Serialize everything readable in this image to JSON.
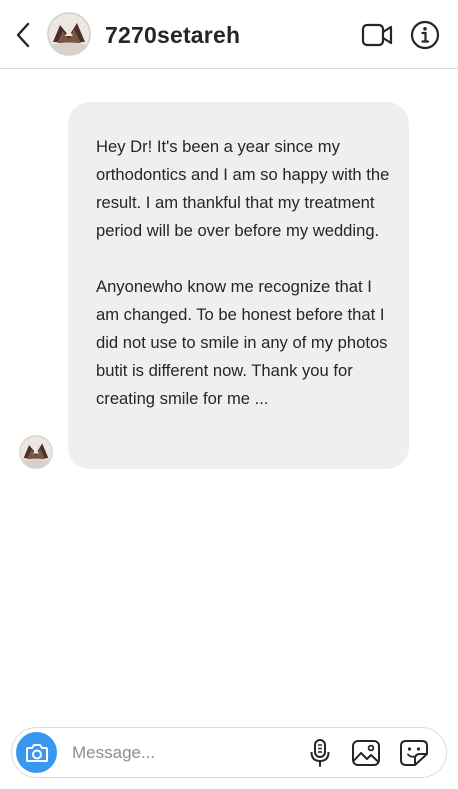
{
  "header": {
    "username": "7270setareh",
    "icons": {
      "back": "chevron-left-icon",
      "video": "video-camera-icon",
      "info": "info-icon"
    }
  },
  "thread": {
    "messages": [
      {
        "paragraphs": [
          "Hey Dr! It's been a year since my orthodontics and I am so happy with the result. I am thankful that my treatment period will be over before my wedding.",
          "Anyonewho know me recognize that I am changed. To be honest before that I did not use to smile in any of my photos butit is different now. Thank you for creating smile for me ..."
        ]
      }
    ]
  },
  "composer": {
    "placeholder": "Message...",
    "value": "",
    "icons": {
      "camera": "camera-icon",
      "mic": "microphone-icon",
      "gallery": "image-gallery-icon",
      "sticker": "sticker-icon"
    }
  },
  "colors": {
    "accent": "#3897f0",
    "bubble": "#efefef",
    "text": "#262626",
    "placeholder": "#8e8e8e",
    "divider": "#dbdbdb"
  }
}
